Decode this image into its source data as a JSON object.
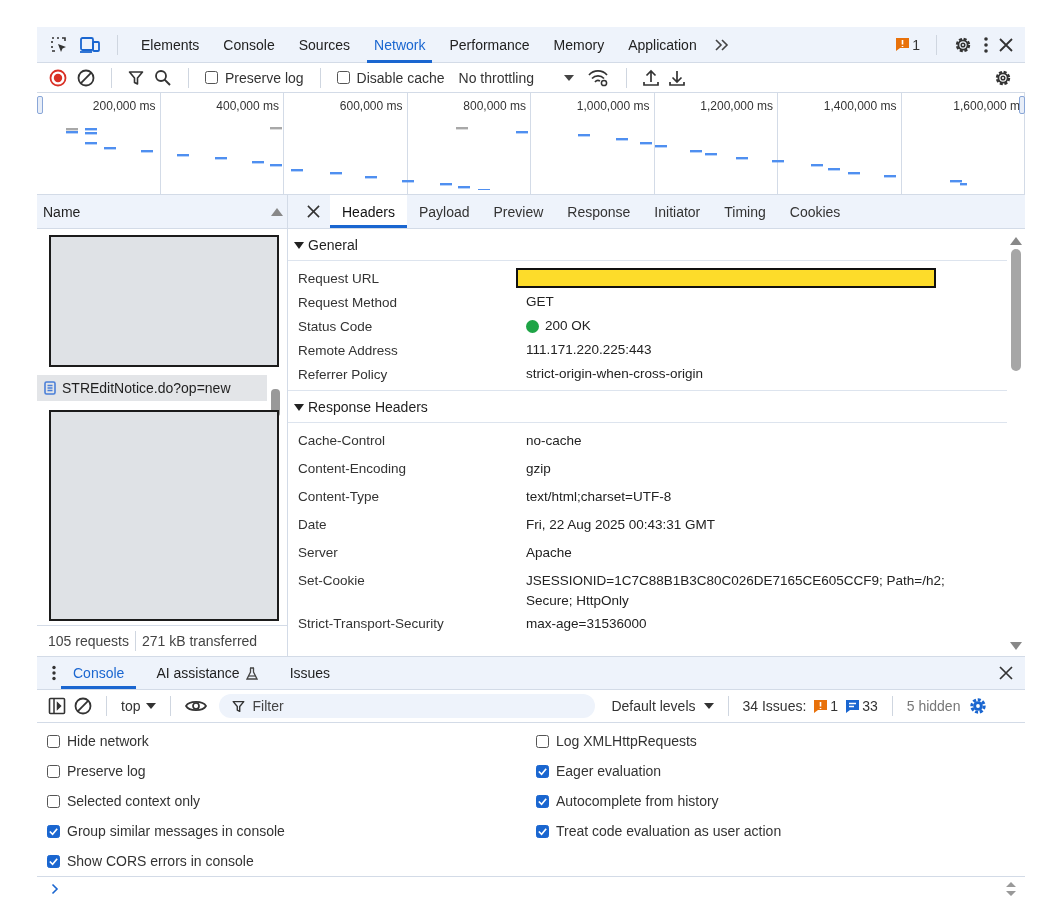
{
  "main_tabs": [
    {
      "label": "Elements",
      "selected": false
    },
    {
      "label": "Console",
      "selected": false
    },
    {
      "label": "Sources",
      "selected": false
    },
    {
      "label": "Network",
      "selected": true
    },
    {
      "label": "Performance",
      "selected": false
    },
    {
      "label": "Memory",
      "selected": false
    },
    {
      "label": "Application",
      "selected": false
    }
  ],
  "issues_badge": "1",
  "network_toolbar": {
    "options": [
      {
        "label": "Preserve log",
        "checked": false
      },
      {
        "label": "Disable cache",
        "checked": false
      }
    ],
    "throttling": "No throttling"
  },
  "overview": {
    "tick_labels": [
      "200,000 ms",
      "400,000 ms",
      "600,000 ms",
      "800,000 ms",
      "1,000,000 ms",
      "1,200,000 ms",
      "1,400,000 ms",
      "1,600,000 m"
    ]
  },
  "request_list": {
    "column": "Name",
    "requests": [
      {
        "kind": "document",
        "name": "STREditNotice.do?op=new",
        "selected": true
      }
    ],
    "summary": [
      "105 requests",
      "271 kB transferred"
    ]
  },
  "details": {
    "tabs": [
      {
        "label": "Headers",
        "selected": true
      },
      {
        "label": "Payload",
        "selected": false
      },
      {
        "label": "Preview",
        "selected": false
      },
      {
        "label": "Response",
        "selected": false
      },
      {
        "label": "Initiator",
        "selected": false
      },
      {
        "label": "Timing",
        "selected": false
      },
      {
        "label": "Cookies",
        "selected": false
      }
    ],
    "sections": [
      {
        "title": "General",
        "expanded": true,
        "kind": "general",
        "rows": [
          {
            "key": "Request URL",
            "redacted": true
          },
          {
            "key": "Request Method",
            "value": "GET"
          },
          {
            "key": "Status Code",
            "value": "200 OK",
            "color": "#1ea446"
          },
          {
            "key": "Remote Address",
            "value": "111.171.220.225:443"
          },
          {
            "key": "Referrer Policy",
            "value": "strict-origin-when-cross-origin"
          }
        ]
      },
      {
        "title": "Response Headers",
        "expanded": true,
        "kind": "headers",
        "rows": [
          {
            "key": "Cache-Control",
            "value": "no-cache"
          },
          {
            "key": "Content-Encoding",
            "value": "gzip"
          },
          {
            "key": "Content-Type",
            "value": "text/html;charset=UTF-8"
          },
          {
            "key": "Date",
            "value": "Fri, 22 Aug 2025 00:43:31 GMT"
          },
          {
            "key": "Server",
            "value": "Apache"
          },
          {
            "key": "Set-Cookie",
            "value": "JSESSIONID=1C7C88B1B3C80C026DE7165CE605CCF9; Path=/h2; Secure; HttpOnly"
          },
          {
            "key": "Strict-Transport-Security",
            "value": "max-age=31536000"
          }
        ]
      }
    ]
  },
  "drawer": {
    "tabs": [
      {
        "label": "Console",
        "selected": true,
        "experimental": false
      },
      {
        "label": "AI assistance",
        "selected": false,
        "experimental": true
      },
      {
        "label": "Issues",
        "selected": false,
        "experimental": false
      }
    ],
    "context": "top",
    "filter_placeholder": "Filter",
    "levels": "Default levels",
    "issues_label": "34 Issues:",
    "issue_counts": [
      {
        "kind": "warning",
        "count": "1"
      },
      {
        "kind": "info",
        "count": "33"
      }
    ],
    "hidden": "5 hidden",
    "settings_left": [
      {
        "label": "Hide network",
        "checked": false
      },
      {
        "label": "Preserve log",
        "checked": false
      },
      {
        "label": "Selected context only",
        "checked": false
      },
      {
        "label": "Group similar messages in console",
        "checked": true
      },
      {
        "label": "Show CORS errors in console",
        "checked": true
      }
    ],
    "settings_right": [
      {
        "label": "Log XMLHttpRequests",
        "checked": false
      },
      {
        "label": "Eager evaluation",
        "checked": true
      },
      {
        "label": "Autocomplete from history",
        "checked": true
      },
      {
        "label": "Treat code evaluation as user action",
        "checked": true
      }
    ]
  }
}
